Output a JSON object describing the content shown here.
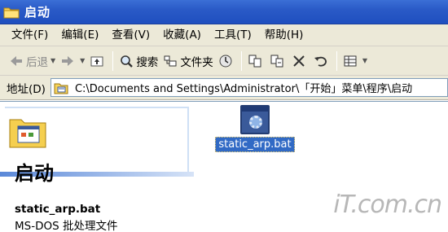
{
  "window": {
    "title": "启动"
  },
  "menu": {
    "items": [
      "文件(F)",
      "编辑(E)",
      "查看(V)",
      "收藏(A)",
      "工具(T)",
      "帮助(H)"
    ]
  },
  "toolbar": {
    "back_label": "后退",
    "search_label": "搜索",
    "folders_label": "文件夹"
  },
  "address": {
    "label": "地址(D)",
    "path": "C:\\Documents and Settings\\Administrator\\「开始」菜单\\程序\\启动"
  },
  "content": {
    "folder_title": "启动",
    "selected_file_name": "static_arp.bat",
    "selected_file_type": "MS-DOS 批处理文件",
    "files": [
      {
        "name": "static_arp.bat",
        "icon": "batch-file-icon"
      }
    ]
  },
  "watermark": {
    "text": "iT.com.cn"
  },
  "colors": {
    "titlebar": "#2a5ac7",
    "chrome": "#ece9d8",
    "selection": "#316ac5"
  }
}
